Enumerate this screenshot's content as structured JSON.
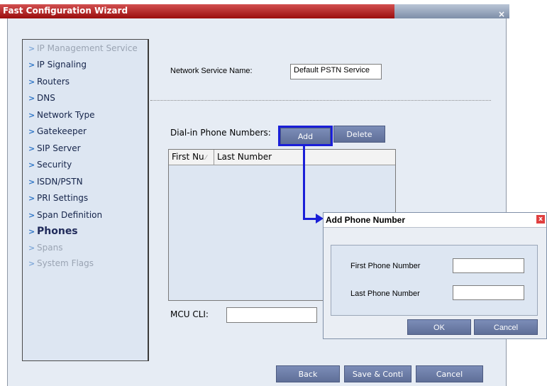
{
  "window": {
    "title": "Fast Configuration Wizard",
    "close_glyph": "×"
  },
  "sidebar": {
    "items": [
      {
        "label": "IP Management Service",
        "state": "disabled"
      },
      {
        "label": "IP Signaling",
        "state": "normal"
      },
      {
        "label": "Routers",
        "state": "normal"
      },
      {
        "label": "DNS",
        "state": "normal"
      },
      {
        "label": "Network Type",
        "state": "normal"
      },
      {
        "label": "Gatekeeper",
        "state": "normal"
      },
      {
        "label": "SIP Server",
        "state": "normal"
      },
      {
        "label": "Security",
        "state": "normal"
      },
      {
        "label": "ISDN/PSTN",
        "state": "normal"
      },
      {
        "label": "PRI Settings",
        "state": "normal"
      },
      {
        "label": "Span Definition",
        "state": "normal"
      },
      {
        "label": "Phones",
        "state": "active"
      },
      {
        "label": "Spans",
        "state": "disabled"
      },
      {
        "label": "System Flags",
        "state": "disabled"
      }
    ],
    "chevron_glyph": ">"
  },
  "main": {
    "network_service_label": "Network Service Name:",
    "network_service_value": "Default PSTN Service",
    "dialin_label": "Dial-in Phone Numbers:",
    "add_label": "Add",
    "delete_label": "Delete",
    "table": {
      "columns": [
        "First Nu",
        "Last Number"
      ],
      "sort_glyph": "⁄",
      "rows": []
    },
    "mcu_cli_label": "MCU CLI:",
    "mcu_cli_value": ""
  },
  "dialog": {
    "title": "Add Phone Number",
    "close_glyph": "x",
    "first_label": "First Phone Number",
    "first_value": "",
    "last_label": "Last Phone Number",
    "last_value": "",
    "ok_label": "OK",
    "cancel_label": "Cancel"
  },
  "footer": {
    "back_label": "Back",
    "save_label": "Save & Conti",
    "cancel_label": "Cancel"
  },
  "colors": {
    "title_red": "#b11d1d",
    "button": "#6e7fa8",
    "highlight": "#1a1fd8",
    "panel": "#dde6f2"
  }
}
